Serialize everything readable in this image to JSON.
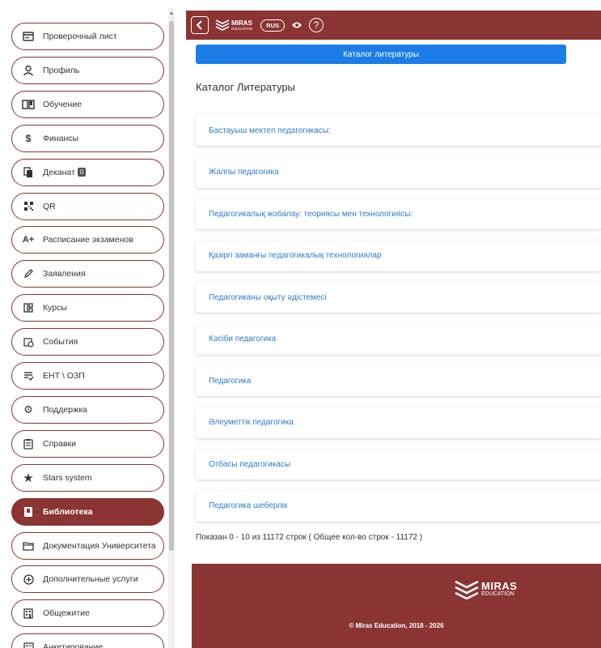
{
  "sidebar": {
    "items": [
      {
        "label": "Проверочный лист",
        "icon": "checklist-card-icon"
      },
      {
        "label": "Профиль",
        "icon": "user-icon"
      },
      {
        "label": "Обучение",
        "icon": "book-open-icon"
      },
      {
        "label": "Финансы",
        "icon": "dollar-icon"
      },
      {
        "label": "Деканат",
        "icon": "copy-icon",
        "badge": "0"
      },
      {
        "label": "QR",
        "icon": "qr-icon"
      },
      {
        "label": "Расписание экзаменов",
        "icon": "grade-a-plus-icon"
      },
      {
        "label": "Заявления",
        "icon": "pencil-icon"
      },
      {
        "label": "Курсы",
        "icon": "grid-icon"
      },
      {
        "label": "События",
        "icon": "calendar-clock-icon"
      },
      {
        "label": "ЕНТ \\ ОЗП",
        "icon": "list-check-icon"
      },
      {
        "label": "Поддержка",
        "icon": "gear-icon"
      },
      {
        "label": "Справки",
        "icon": "clipboard-icon"
      },
      {
        "label": "Stars system",
        "icon": "star-icon"
      },
      {
        "label": "Библиотека",
        "icon": "book-icon",
        "active": true
      },
      {
        "label": "Документация Университета",
        "icon": "folder-icon"
      },
      {
        "label": "Дополнительные услуги",
        "icon": "plus-circle-icon"
      },
      {
        "label": "Общежитие",
        "icon": "building-icon"
      },
      {
        "label": "Анкетирование",
        "icon": "survey-icon"
      }
    ]
  },
  "header": {
    "logo_title": "MIRAS",
    "logo_sub": "EDUCATION",
    "lang": "RUS",
    "help": "?"
  },
  "main": {
    "catalog_button": "Каталог литературы",
    "title": "Каталог Литературы",
    "rows": [
      "Бастауыш мектеп педагогикасы:",
      "Жалпы педагогика",
      "Педагогикалық жобалау: теориясы мен технологиясы:",
      "Қазіргі заманғы педагогикалық технологиялар",
      "Педагогиканы оқыту әдістемесі",
      "Кәсіби педагогика",
      "Педагогика",
      "Әлеуметтік педагогика",
      "Отбасы педагогикасы",
      "Педагогика шеберлік"
    ],
    "summary": "Показан 0 - 10 из 11172 строк ( Общее кол-во строк - 11172 )"
  },
  "footer": {
    "logo_title": "MIRAS",
    "logo_sub": "EDUCATION",
    "copyright": "© Miras Education, 2018 - 2026"
  },
  "colors": {
    "brand": "#8b3434",
    "primary_button": "#1a7de8",
    "link": "#2c7bd0"
  }
}
